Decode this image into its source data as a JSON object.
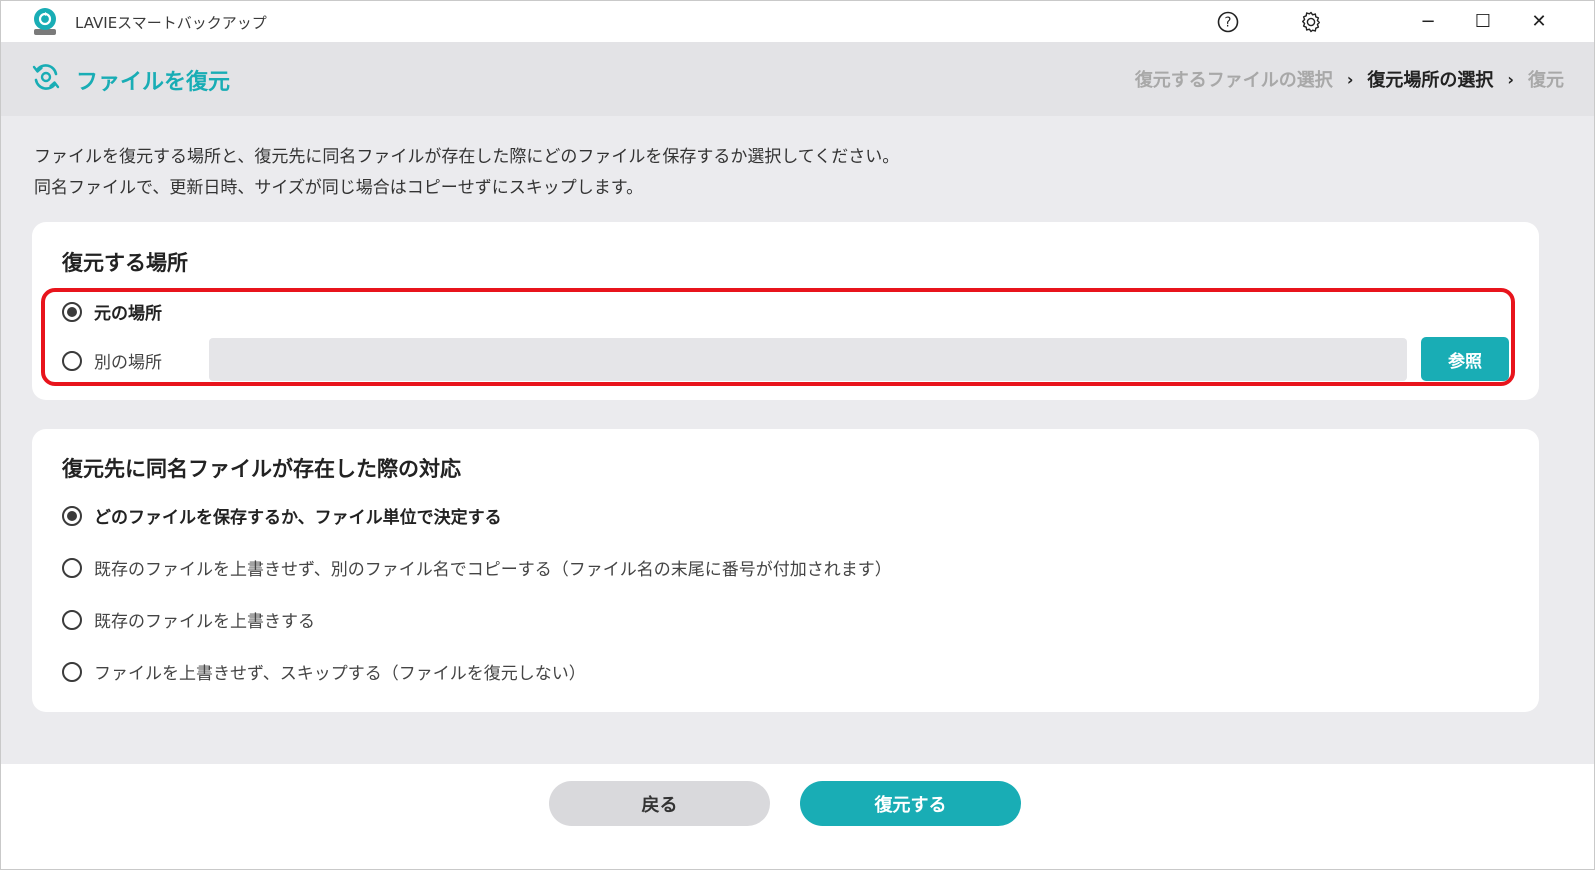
{
  "app": {
    "title": "LAVIEスマートバックアップ"
  },
  "window_controls": {
    "minimize": "−",
    "maximize": "☐",
    "close": "✕"
  },
  "header": {
    "title": "ファイルを復元",
    "breadcrumb": [
      {
        "label": "復元するファイルの選択",
        "state": "done"
      },
      {
        "label": "復元場所の選択",
        "state": "current"
      },
      {
        "label": "復元",
        "state": "pending"
      }
    ],
    "separator": "›"
  },
  "description": {
    "line1": "ファイルを復元する場所と、復元先に同名ファイルが存在した際にどのファイルを保存するか選択してください。",
    "line2": "同名ファイルで、更新日時、サイズが同じ場合はコピーせずにスキップします。"
  },
  "location": {
    "heading": "復元する場所",
    "options": [
      {
        "label": "元の場所",
        "selected": true
      },
      {
        "label": "別の場所",
        "selected": false
      }
    ],
    "path_value": "",
    "browse_label": "参照"
  },
  "conflict": {
    "heading": "復元先に同名ファイルが存在した際の対応",
    "options": [
      {
        "label": "どのファイルを保存するか、ファイル単位で決定する",
        "selected": true
      },
      {
        "label": "既存のファイルを上書きせず、別のファイル名でコピーする（ファイル名の末尾に番号が付加されます）",
        "selected": false
      },
      {
        "label": "既存のファイルを上書きする",
        "selected": false
      },
      {
        "label": "ファイルを上書きせず、スキップする（ファイルを復元しない）",
        "selected": false
      }
    ]
  },
  "footer": {
    "back_label": "戻る",
    "restore_label": "復元する"
  },
  "colors": {
    "accent": "#19adb5",
    "highlight": "#e8141c",
    "header_bg": "#e3e3e6",
    "content_bg": "#ebebee"
  },
  "icons": [
    "app-logo-icon",
    "help-icon",
    "gear-icon",
    "restore-sync-icon",
    "radio-icon"
  ]
}
